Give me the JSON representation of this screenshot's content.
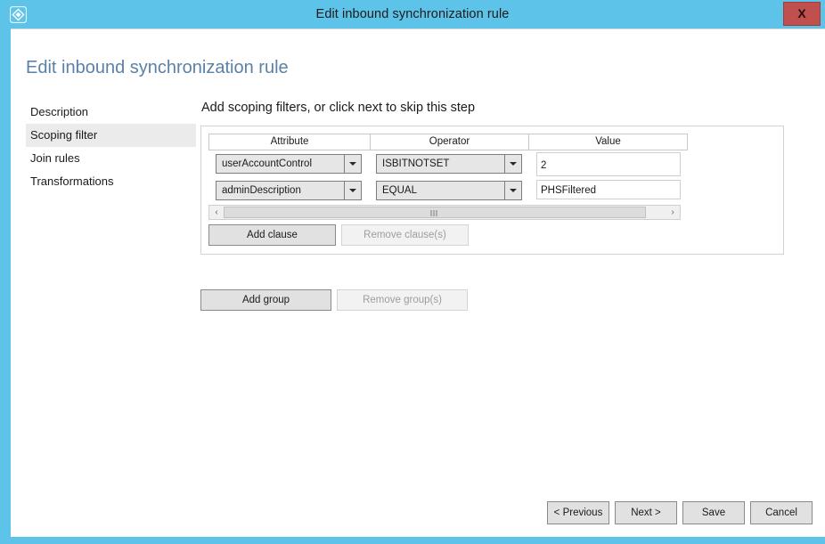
{
  "window": {
    "title": "Edit inbound synchronization rule",
    "icon": "azure-diamond-icon",
    "close_label": "X",
    "accent_color": "#5ec3e8",
    "close_color": "#c0504d"
  },
  "page": {
    "title": "Edit inbound synchronization rule",
    "title_color": "#5a81a8"
  },
  "nav": {
    "items": [
      {
        "label": "Description",
        "selected": false
      },
      {
        "label": "Scoping filter",
        "selected": true
      },
      {
        "label": "Join rules",
        "selected": false
      },
      {
        "label": "Transformations",
        "selected": false
      }
    ]
  },
  "main": {
    "heading": "Add scoping filters, or click next to skip this step",
    "grid": {
      "columns": [
        "Attribute",
        "Operator",
        "Value"
      ],
      "rows": [
        {
          "attribute": "userAccountControl",
          "operator": "ISBITNOTSET",
          "value": "2"
        },
        {
          "attribute": "adminDescription",
          "operator": "EQUAL",
          "value": "PHSFiltered"
        }
      ]
    },
    "scrollbar": {
      "left_arrow": "‹",
      "right_arrow": "›"
    },
    "clause_buttons": {
      "add": {
        "label": "Add clause",
        "enabled": true
      },
      "remove": {
        "label": "Remove clause(s)",
        "enabled": false
      }
    },
    "group_buttons": {
      "add": {
        "label": "Add group",
        "enabled": true
      },
      "remove": {
        "label": "Remove group(s)",
        "enabled": false
      }
    }
  },
  "footer": {
    "buttons": [
      {
        "label": "< Previous"
      },
      {
        "label": "Next >"
      },
      {
        "label": "Save"
      },
      {
        "label": "Cancel"
      }
    ]
  }
}
